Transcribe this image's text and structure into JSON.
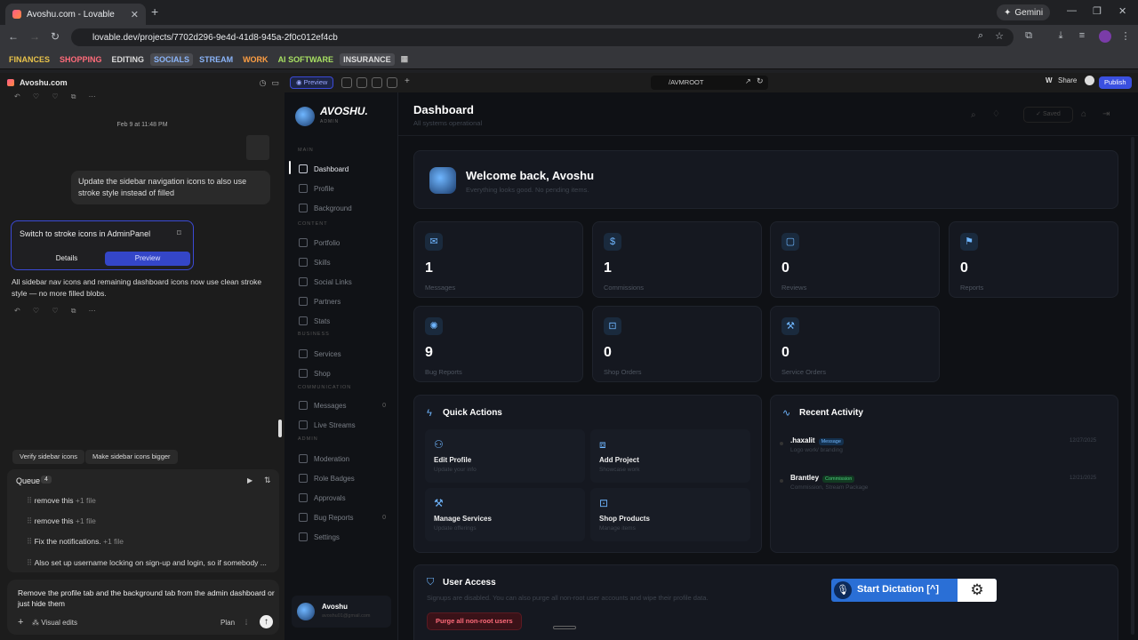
{
  "browser": {
    "tab_title": "Avoshu.com - Lovable",
    "url": "lovable.dev/projects/7702d296-9e4d-41d8-945a-2f0c012ef4cb",
    "gemini_label": "Gemini",
    "bookmarks": [
      {
        "label": "FINANCES",
        "color": "#e8c24a"
      },
      {
        "label": "SHOPPING",
        "color": "#ff6b7a"
      },
      {
        "label": "EDITING",
        "color": "#dddddd"
      },
      {
        "label": "SOCIALS",
        "color": "#8ab4f8"
      },
      {
        "label": "STREAM",
        "color": "#8ab4f8"
      },
      {
        "label": "WORK",
        "color": "#ff9f43"
      },
      {
        "label": "AI SOFTWARE",
        "color": "#a8e063"
      },
      {
        "label": "INSURANCE",
        "color": "#dddddd"
      }
    ]
  },
  "chat": {
    "project_name": "Avoshu.com",
    "timestamp": "Feb 9 at 11:48 PM",
    "user_message": "Update the sidebar navigation icons to also use stroke style instead of filled",
    "card_title": "Switch to stroke icons in AdminPanel",
    "card_details": "Details",
    "card_preview": "Preview",
    "assistant_message": "All sidebar nav icons and remaining dashboard icons now use clean stroke style — no more filled blobs.",
    "suggestions": [
      "Verify sidebar icons",
      "Make sidebar icons bigger"
    ],
    "queue_label": "Queue",
    "queue_count": "4",
    "queue_items": [
      {
        "text": "remove this",
        "meta": "+1 file"
      },
      {
        "text": "remove this",
        "meta": "+1 file"
      },
      {
        "text": "Fix the notifications.",
        "meta": "+1 file"
      },
      {
        "text": "Also set up username locking on sign-up and login, so if somebody ...",
        "meta": ""
      }
    ],
    "input_text": "Remove the profile tab and the background tab from the admin dashboard or just hide them",
    "visual_edits": "Visual edits",
    "plan": "Plan"
  },
  "preview_toolbar": {
    "preview": "Preview",
    "route": "/AVMROOT",
    "share": "Share",
    "publish": "Publish"
  },
  "app": {
    "brand": "AVOSHU.",
    "brand_sub": "ADMIN",
    "sections": {
      "main": "MAIN",
      "content": "CONTENT",
      "business": "BUSINESS",
      "communication": "COMMUNICATION",
      "admin": "ADMIN"
    },
    "nav": [
      {
        "label": "Dashboard",
        "active": true,
        "count": ""
      },
      {
        "label": "Profile",
        "count": ""
      },
      {
        "label": "Background",
        "count": ""
      },
      {
        "label": "Portfolio",
        "count": ""
      },
      {
        "label": "Skills",
        "count": ""
      },
      {
        "label": "Social Links",
        "count": ""
      },
      {
        "label": "Partners",
        "count": ""
      },
      {
        "label": "Stats",
        "count": ""
      },
      {
        "label": "Services",
        "count": ""
      },
      {
        "label": "Shop",
        "count": ""
      },
      {
        "label": "Messages",
        "count": "0"
      },
      {
        "label": "Live Streams",
        "count": ""
      },
      {
        "label": "Moderation",
        "count": ""
      },
      {
        "label": "Role Badges",
        "count": ""
      },
      {
        "label": "Approvals",
        "count": ""
      },
      {
        "label": "Bug Reports",
        "count": "0"
      },
      {
        "label": "Settings",
        "count": ""
      }
    ],
    "user_name": "Avoshu",
    "user_email": "avoshu01@gmail.com",
    "title": "Dashboard",
    "subtitle": "All systems operational",
    "saved": "Saved",
    "welcome_title": "Welcome back, Avoshu",
    "welcome_sub": "Everything looks good. No pending items.",
    "stats": [
      {
        "value": "1",
        "label": "Messages",
        "icon": "mail-icon"
      },
      {
        "value": "1",
        "label": "Commissions",
        "icon": "dollar-icon"
      },
      {
        "value": "0",
        "label": "Reviews",
        "icon": "chat-icon"
      },
      {
        "value": "0",
        "label": "Reports",
        "icon": "flag-icon"
      },
      {
        "value": "9",
        "label": "Bug Reports",
        "icon": "bug-icon"
      },
      {
        "value": "0",
        "label": "Shop Orders",
        "icon": "bag-icon"
      },
      {
        "value": "0",
        "label": "Service Orders",
        "icon": "wrench-icon"
      }
    ],
    "quick_actions_title": "Quick Actions",
    "quick_actions": [
      {
        "title": "Edit Profile",
        "sub": "Update your info"
      },
      {
        "title": "Add Project",
        "sub": "Showcase work"
      },
      {
        "title": "Manage Services",
        "sub": "Update offerings"
      },
      {
        "title": "Shop Products",
        "sub": "Manage items"
      }
    ],
    "recent_title": "Recent Activity",
    "recent": [
      {
        "name": ".haxalit",
        "badge": "Message",
        "desc": "Logo work/ branding",
        "date": "12/27/2025"
      },
      {
        "name": "Brantley",
        "badge": "Commission",
        "desc": "Commission, Stream Package",
        "date": "12/21/2025"
      }
    ],
    "user_access_title": "User Access",
    "user_access_desc": "Signups are disabled. You can also purge all non-root user accounts and wipe their profile data.",
    "purge_button": "Purge all non-root users",
    "dictation_label": "Start Dictation [^]"
  }
}
